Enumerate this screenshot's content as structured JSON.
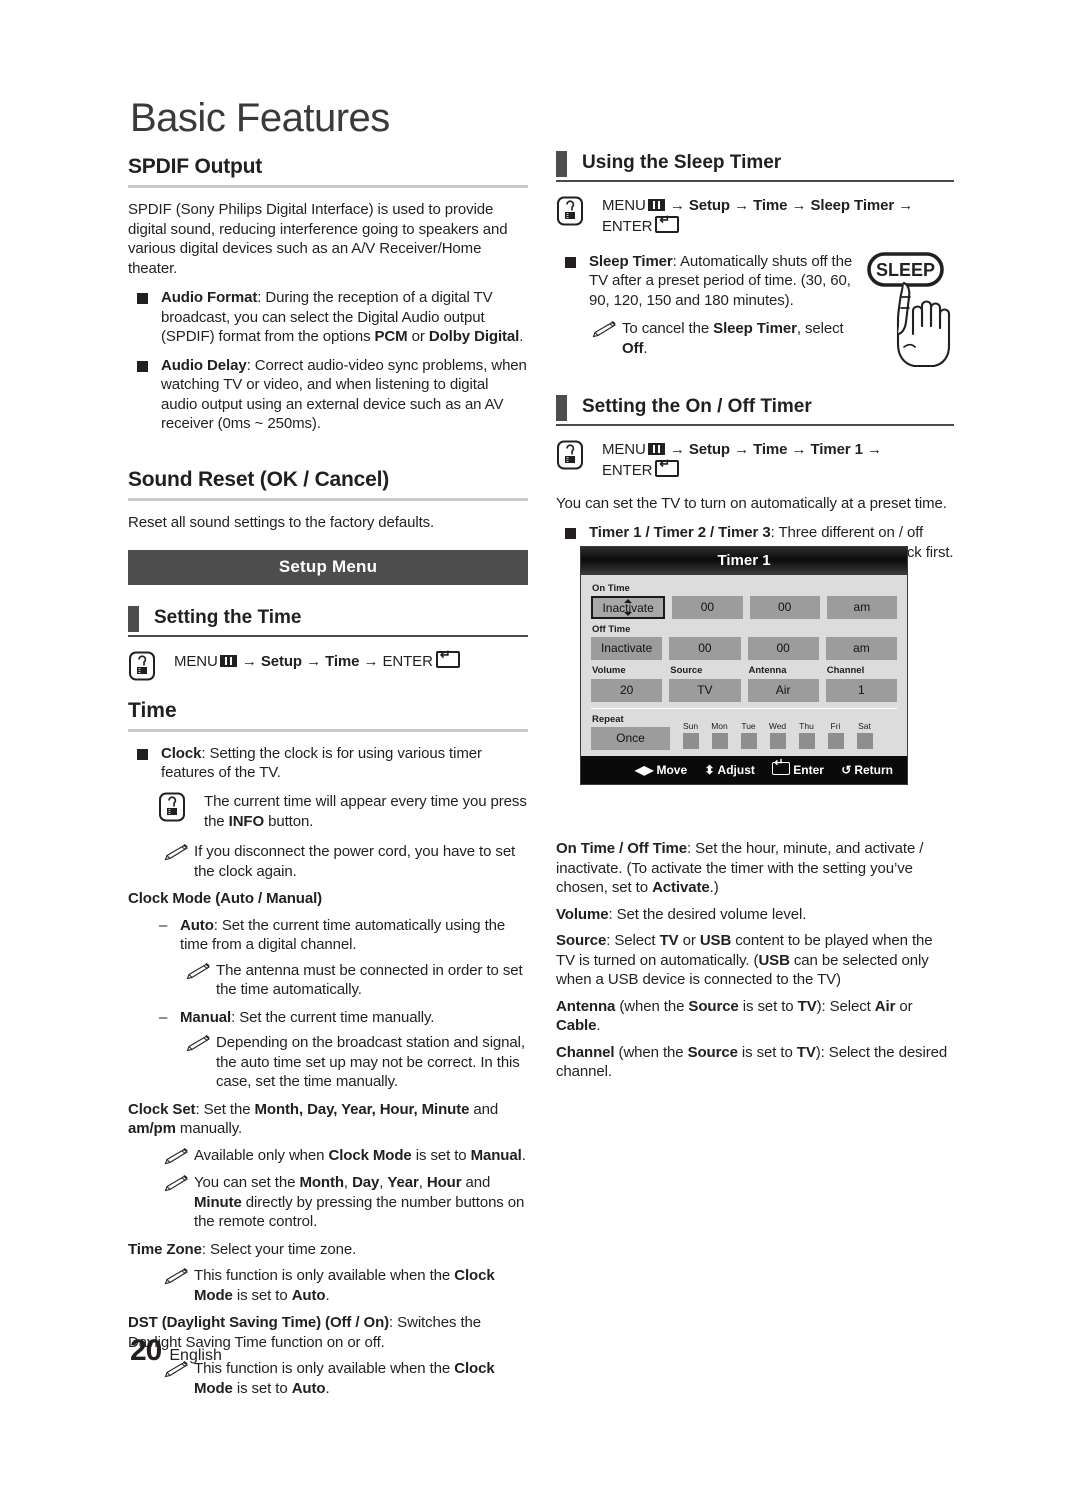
{
  "page": {
    "title": "Basic Features",
    "page_number": "20",
    "language": "English"
  },
  "left": {
    "spdif": {
      "heading": "SPDIF Output",
      "intro": "SPDIF (Sony Philips Digital Interface) is used to provide digital sound, reducing interference going to speakers and various digital devices such as an A/V Receiver/Home theater.",
      "items": [
        {
          "term": "Audio Format",
          "text": ": During the reception of a digital TV broadcast, you can select the Digital Audio output (SPDIF) format from the options ",
          "bold_a": "PCM",
          "mid": " or ",
          "bold_b": "Dolby Digital",
          "tail": "."
        },
        {
          "term": "Audio Delay",
          "text": ": Correct audio-video sync problems, when watching TV or video, and when listening to digital audio output using an external device such as an AV receiver (0ms ~ 250ms)."
        }
      ]
    },
    "sound_reset": {
      "heading": "Sound Reset (OK / Cancel)",
      "body": "Reset all sound settings to the factory defaults."
    },
    "band_label": "Setup Menu",
    "setting_time": {
      "heading": "Setting the Time",
      "path": {
        "menu": "MENU",
        "arrow": "→",
        "step1": "Setup",
        "step2": "Time",
        "enter": "ENTER"
      }
    },
    "time": {
      "heading": "Time",
      "clock_term": "Clock",
      "clock_text": ": Setting the clock is for using various timer features of the TV.",
      "note_info_a": "The current time will appear every time you press the ",
      "note_info_b": "INFO",
      "note_info_c": " button.",
      "note_cord": "If you disconnect the power cord, you have to set the clock again.",
      "clock_mode_heading": "Clock Mode (Auto / Manual)",
      "auto_term": "Auto",
      "auto_text": ": Set the current time automatically using the time from a digital channel.",
      "auto_note": "The antenna must be connected in order to set the time automatically.",
      "manual_term": "Manual",
      "manual_text": ": Set the current time manually.",
      "manual_note": "Depending on the broadcast station and signal, the auto time set up may not be correct. In this case, set the time manually.",
      "clock_set_term": "Clock Set",
      "clock_set_a": ": Set the ",
      "clock_set_bold": "Month, Day, Year, Hour, Minute",
      "clock_set_b": " and ",
      "clock_set_bold2": "am/pm",
      "clock_set_c": " manually.",
      "clock_set_note1_a": "Available only when ",
      "clock_set_note1_b": "Clock Mode",
      "clock_set_note1_c": " is set to ",
      "clock_set_note1_d": "Manual",
      "clock_set_note1_e": ".",
      "clock_set_note2_a": "You can set the ",
      "clock_set_note2_m": "Month",
      "clock_set_note2_d": "Day",
      "clock_set_note2_y": "Year",
      "clock_set_note2_h": "Hour",
      "clock_set_note2_and": " and ",
      "clock_set_note2_min": "Minute",
      "clock_set_note2_tail": " directly by pressing the number buttons on the remote control.",
      "time_zone_term": "Time Zone",
      "time_zone_text": ": Select your time zone.",
      "time_zone_note_a": "This function is only available when the ",
      "time_zone_note_b": "Clock Mode",
      "time_zone_note_c": " is set to ",
      "time_zone_note_d": "Auto",
      "time_zone_note_e": ".",
      "dst_term": "DST (Daylight Saving Time) (Off / On)",
      "dst_text": ": Switches the Daylight Saving Time function on or off.",
      "dst_note_a": "This function is only available when the ",
      "dst_note_b": "Clock Mode",
      "dst_note_c": " is set to ",
      "dst_note_d": "Auto",
      "dst_note_e": "."
    }
  },
  "right": {
    "sleep_timer": {
      "heading": "Using the Sleep Timer",
      "path": {
        "menu": "MENU",
        "arrow": "→",
        "step1": "Setup",
        "step2": "Time",
        "step3": "Sleep Timer",
        "enter": "ENTER"
      },
      "item_term": "Sleep Timer",
      "item_text": ": Automatically shuts off the TV after a preset period of time. (30, 60, 90, 120, 150 and 180 minutes).",
      "note_a": "To cancel the ",
      "note_b": "Sleep Timer",
      "note_c": ", select ",
      "note_d": "Off",
      "note_e": ".",
      "remote_button_label": "SLEEP"
    },
    "on_off_timer": {
      "heading": "Setting the On / Off Timer",
      "path": {
        "menu": "MENU",
        "arrow": "→",
        "step1": "Setup",
        "step2": "Time",
        "step3": "Timer 1",
        "enter": "ENTER"
      },
      "intro": "You can set the TV to turn on automatically at a preset time.",
      "item_term": "Timer 1 / Timer 2 / Timer 3",
      "item_text": ": Three different on / off timer settings can be made. You must set the clock first."
    },
    "osd": {
      "title": "Timer 1",
      "on_time_label": "On Time",
      "on_time_values": [
        "Inactivate",
        "00",
        "00",
        "am"
      ],
      "off_time_label": "Off Time",
      "off_time_values": [
        "Inactivate",
        "00",
        "00",
        "am"
      ],
      "field_labels": [
        "Volume",
        "Source",
        "Antenna",
        "Channel"
      ],
      "field_values": [
        "20",
        "TV",
        "Air",
        "1"
      ],
      "repeat_label": "Repeat",
      "repeat_value": "Once",
      "days": [
        "Sun",
        "Mon",
        "Tue",
        "Wed",
        "Thu",
        "Fri",
        "Sat"
      ],
      "footer_keys": [
        {
          "icon": "◀▶",
          "label": "Move"
        },
        {
          "icon": "⬍",
          "label": "Adjust"
        },
        {
          "icon": "enter-glyph",
          "label": "Enter"
        },
        {
          "icon": "↺",
          "label": "Return"
        }
      ]
    },
    "descriptions": {
      "on_off_term": "On Time / Off Time",
      "on_off_a": ": Set the hour, minute, and activate / inactivate. (To activate the timer with the setting you’ve chosen, set to ",
      "on_off_bold": "Activate",
      "on_off_b": ".)",
      "volume_term": "Volume",
      "volume_text": ": Set the desired volume level.",
      "source_term": "Source",
      "source_a": ": Select ",
      "source_tv": "TV",
      "source_or": " or ",
      "source_usb": "USB",
      "source_b": " content to be played when the TV is turned on automatically. (",
      "source_usb2": "USB",
      "source_c": " can be selected only when a USB device is connected to the TV)",
      "antenna_term": "Antenna",
      "antenna_a": " (when the ",
      "antenna_source": "Source",
      "antenna_b": " is set to ",
      "antenna_tv": "TV",
      "antenna_c": "): Select ",
      "antenna_air": "Air",
      "antenna_or": " or ",
      "antenna_cable": "Cable",
      "antenna_d": ".",
      "channel_term": "Channel",
      "channel_a": " (when the ",
      "channel_source": "Source",
      "channel_b": " is set to ",
      "channel_tv": "TV",
      "channel_c": "): Select the desired channel."
    }
  }
}
